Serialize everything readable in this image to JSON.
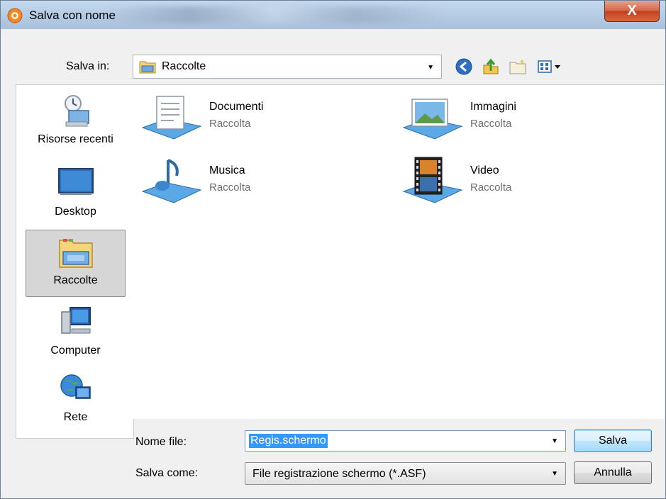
{
  "window": {
    "title": "Salva con nome",
    "close_label": "X"
  },
  "save_in": {
    "label": "Salva in:",
    "value": "Raccolte"
  },
  "toolbar": {
    "icons": [
      "back-icon",
      "up-folder-icon",
      "new-folder-icon",
      "view-menu-icon"
    ]
  },
  "places": [
    {
      "label": "Risorse recenti",
      "icon": "recent-places-icon"
    },
    {
      "label": "Desktop",
      "icon": "desktop-icon"
    },
    {
      "label": "Raccolte",
      "icon": "libraries-icon",
      "selected": true
    },
    {
      "label": "Computer",
      "icon": "computer-icon"
    },
    {
      "label": "Rete",
      "icon": "network-icon"
    }
  ],
  "files": [
    {
      "name": "Documenti",
      "type": "Raccolta",
      "icon": "documents-library-icon"
    },
    {
      "name": "Immagini",
      "type": "Raccolta",
      "icon": "pictures-library-icon"
    },
    {
      "name": "Musica",
      "type": "Raccolta",
      "icon": "music-library-icon"
    },
    {
      "name": "Video",
      "type": "Raccolta",
      "icon": "video-library-icon"
    }
  ],
  "filename": {
    "label": "Nome file:",
    "value": "Regis.schermo"
  },
  "filetype": {
    "label": "Salva come:",
    "value": "File registrazione schermo (*.ASF)"
  },
  "buttons": {
    "save": "Salva",
    "cancel": "Annulla"
  },
  "colors": {
    "selection": "#3399ff",
    "title_bar": "#b4cbe3",
    "close_button": "#c33f1f"
  }
}
